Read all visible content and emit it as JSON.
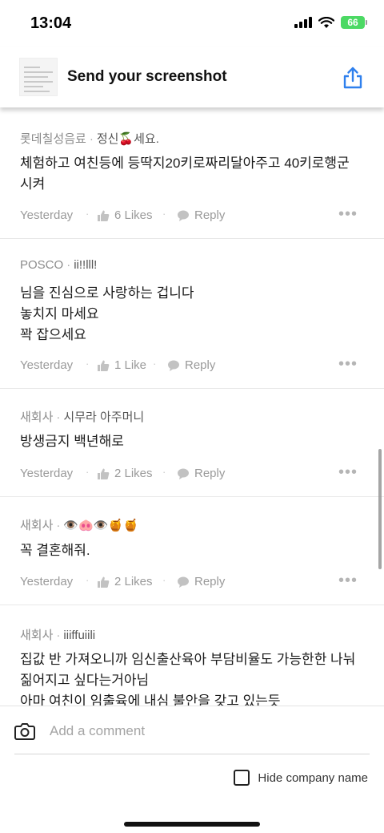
{
  "status_bar": {
    "time": "13:04",
    "battery": "66"
  },
  "banner": {
    "title": "Send your screenshot"
  },
  "comments": [
    {
      "company": "롯데칠성음료",
      "nickname": "정신🍒세요.",
      "lines": [
        "체험하고 여친등에 등딱지20키로짜리달아주고 40키로행군",
        "시켜"
      ],
      "date": "Yesterday",
      "likes": "6 Likes",
      "reply": "Reply"
    },
    {
      "company": "POSCO",
      "nickname": "ii!!lll!",
      "lines": [
        "님을 진심으로 사랑하는 겁니다",
        "놓치지 마세요",
        "꽉 잡으세요"
      ],
      "date": "Yesterday",
      "likes": "1 Like",
      "reply": "Reply"
    },
    {
      "company": "새회사",
      "nickname": "시무라 아주머니",
      "lines": [
        "방생금지 백년해로"
      ],
      "date": "Yesterday",
      "likes": "2 Likes",
      "reply": "Reply"
    },
    {
      "company": "새회사",
      "nickname": "👁️🐽👁️🍯🍯",
      "lines": [
        "꼭 결혼해줘."
      ],
      "date": "Yesterday",
      "likes": "2 Likes",
      "reply": "Reply"
    },
    {
      "company": "새회사",
      "nickname": "iiiffuiili",
      "lines": [
        "집값 반 가져오니까 임신출산육아 부담비율도 가능한한 나눠",
        "짊어지고 싶다는거아님",
        "아마 여친이 임출육에 내심 불안을 갖고 있는듯"
      ],
      "date": "",
      "likes": "",
      "reply": ""
    }
  ],
  "composer": {
    "placeholder": "Add a comment",
    "hide_company_label": "Hide company name"
  },
  "colors": {
    "accent": "#2f80ed",
    "battery": "#4cd964",
    "muted": "#9a9a9a"
  },
  "icons": {
    "share": "share-icon",
    "like": "thumbs-up-icon",
    "reply": "speech-bubble-icon",
    "camera": "camera-icon",
    "more": "more-icon"
  }
}
